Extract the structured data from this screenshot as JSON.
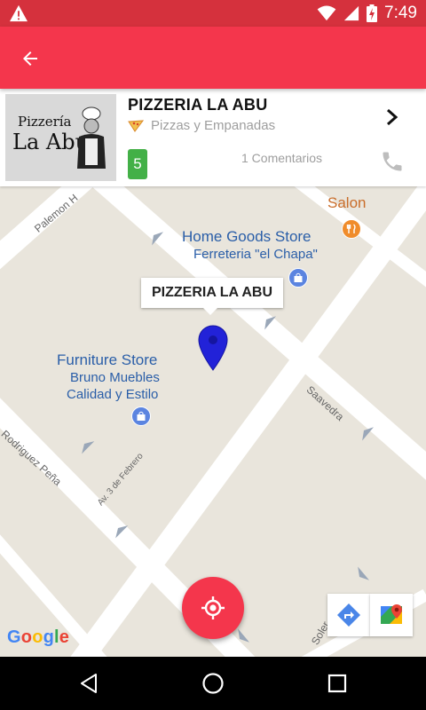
{
  "status_bar": {
    "time": "7:49",
    "icons": [
      "warning-icon",
      "wifi-icon",
      "cell-signal-icon",
      "battery-charging-icon"
    ]
  },
  "app_bar": {
    "background": "#f4364c",
    "back_icon": "arrow-back-icon"
  },
  "place": {
    "thumbnail_text_top": "Pizzería",
    "thumbnail_text_main": "La Abu",
    "name": "PIZZERIA LA ABU",
    "category": "Pizzas y Empanadas",
    "category_icon": "pizza-icon",
    "rating": "5",
    "rating_color": "#43b047",
    "comments": "1 Comentarios"
  },
  "map": {
    "info_window_title": "PIZZERIA LA ABU",
    "pois": {
      "salon": "Salon",
      "home_goods_title": "Home Goods Store",
      "home_goods_sub": "Ferreteria \"el Chapa\"",
      "furniture_title": "Furniture Store",
      "furniture_sub1": "Bruno Muebles",
      "furniture_sub2": "Calidad y Estilo"
    },
    "streets": {
      "palemon": "Palemon H",
      "saavedra": "Saavedra",
      "rodriguez": "Rodriguez Peña",
      "tres_febrero": "Av. 3 de Febrero",
      "soler": "Soler"
    },
    "google_logo": [
      "G",
      "o",
      "o",
      "g",
      "l",
      "e"
    ],
    "tools": [
      "directions-icon",
      "google-maps-icon"
    ],
    "fab_icon": "my-location-icon"
  },
  "nav_bar": {
    "buttons": [
      "back-triangle-icon",
      "home-circle-icon",
      "recents-square-icon"
    ]
  }
}
